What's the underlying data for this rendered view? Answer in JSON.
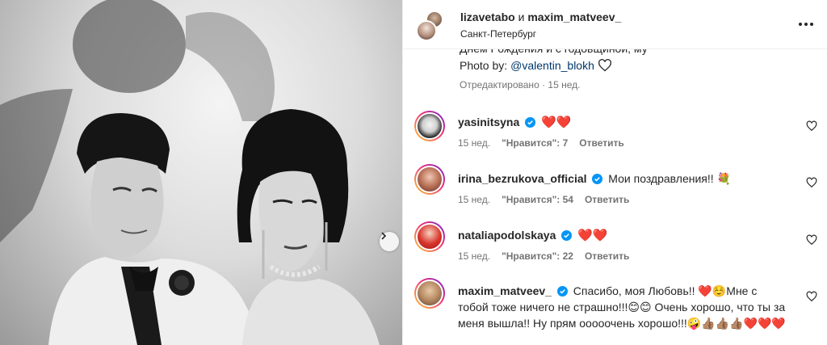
{
  "post": {
    "authors": "lizavetabo",
    "coauthor_joiner": " и ",
    "coauthor": "maxim_matveev_",
    "location": "Санкт-Петербург",
    "more_icon": "more-horizontal-icon",
    "caption_tail": "Днём Рождения и с годовщиной, му",
    "photo_by_prefix": "Photo by:",
    "photo_by_handle": "@valentin_blokh",
    "edited": "Отредактировано · 15 нед."
  },
  "comments": [
    {
      "user": "yasinitsyna",
      "verified": true,
      "text": "❤️❤️",
      "age": "15 нед.",
      "likes": "\"Нравится\": 7",
      "reply": "Ответить",
      "avatar_color": "#111111"
    },
    {
      "user": "irina_bezrukova_official",
      "verified": true,
      "text": "Мои поздравления!! 💐",
      "age": "15 нед.",
      "likes": "\"Нравится\": 54",
      "reply": "Ответить",
      "avatar_color": "#b0413e"
    },
    {
      "user": "nataliapodolskaya",
      "verified": true,
      "text": "❤️❤️",
      "age": "15 нед.",
      "likes": "\"Нравится\": 22",
      "reply": "Ответить",
      "avatar_color": "#c0392b"
    },
    {
      "user": "maxim_matveev_",
      "verified": true,
      "text": "Спасибо, моя Любовь!! ❤️☺️Мне с тобой тоже ничего не страшно!!!😊😊 Очень хорошо, что ты за меня вышла!! Ну прям ооооочень хорошо!!!🤪👍🏽👍🏽👍🏽❤️❤️❤️",
      "avatar_color": "#c8a27a"
    }
  ],
  "colors": {
    "verified": "#0095f6",
    "heart": "#e0212b",
    "muted": "#737373",
    "link": "#00376b"
  }
}
